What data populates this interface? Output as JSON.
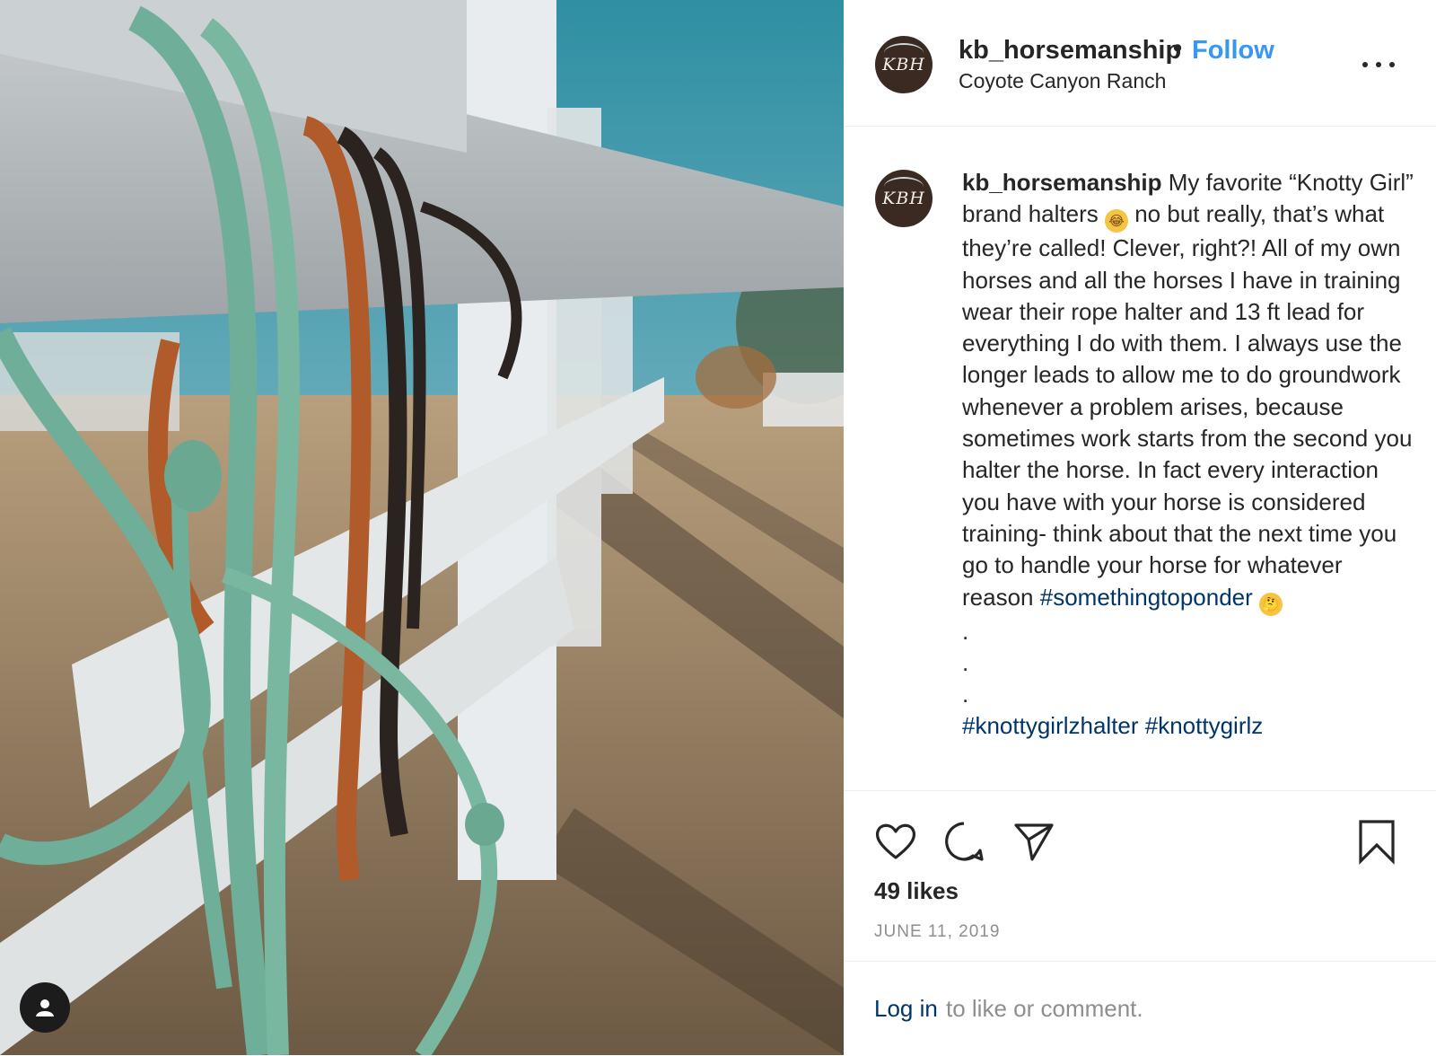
{
  "header": {
    "username": "kb_horsemanship",
    "separator": "•",
    "follow_label": "Follow",
    "location": "Coyote Canyon Ranch",
    "avatar_monogram": "KBH"
  },
  "caption": {
    "username": "kb_horsemanship",
    "text_1": "My favorite “Knotty Girl” brand halters",
    "emoji_1": "😂",
    "text_2": "  no but really, that’s what they’re called! Clever, right?! All of my own horses and all the horses I have in training wear their rope halter and 13 ft lead for everything I do with them. I always use the longer leads to allow me to do groundwork whenever a problem arises, because sometimes work starts from the second you halter the horse. In fact every interaction you have with your horse is considered training- think about that the next time you go to handle your horse for whatever reason",
    "hashtag_1": "#somethingtoponder",
    "emoji_2": "🤔",
    "dot": ".",
    "hashtags_more": "#knottygirlzhalter #knottygirlz"
  },
  "actions": {
    "like_icon": "heart-icon",
    "comment_icon": "comment-icon",
    "share_icon": "paper-plane-icon",
    "save_icon": "bookmark-icon"
  },
  "likes": "49 likes",
  "date": "JUNE 11, 2019",
  "login": {
    "link": "Log in",
    "rest": "to like or comment."
  },
  "colors": {
    "follow": "#3897f0",
    "hashtag": "#003569",
    "muted": "#8e8e8e",
    "text": "#262626"
  }
}
